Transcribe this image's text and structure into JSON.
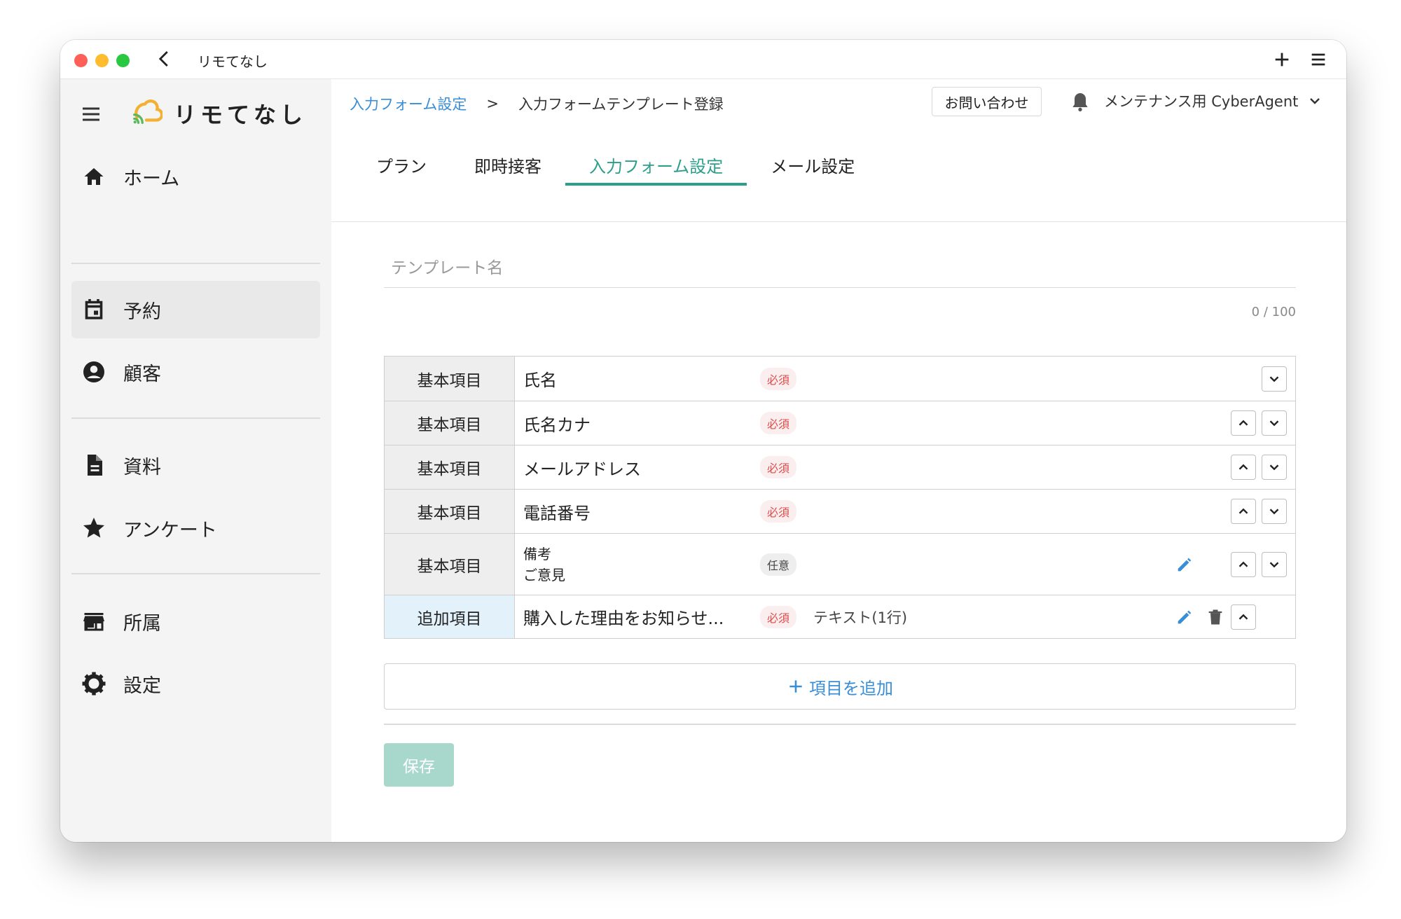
{
  "window": {
    "title": "リモてなし"
  },
  "sidebar": {
    "logo_text": "リモてなし",
    "items": [
      {
        "label": "ホーム",
        "icon": "home-icon"
      },
      {
        "label": "予約",
        "icon": "calendar-icon"
      },
      {
        "label": "顧客",
        "icon": "account-circle-icon"
      },
      {
        "label": "資料",
        "icon": "document-icon"
      },
      {
        "label": "アンケート",
        "icon": "star-icon"
      },
      {
        "label": "所属",
        "icon": "store-icon"
      },
      {
        "label": "設定",
        "icon": "gear-icon"
      }
    ]
  },
  "header": {
    "breadcrumb": {
      "link": "入力フォーム設定",
      "separator": ">",
      "current": "入力フォームテンプレート登録"
    },
    "contact_label": "お問い合わせ",
    "user_name": "メンテナンス用 CyberAgent",
    "tabs": [
      {
        "label": "プラン"
      },
      {
        "label": "即時接客"
      },
      {
        "label": "入力フォーム設定"
      },
      {
        "label": "メール設定"
      }
    ]
  },
  "form": {
    "template_name_placeholder": "テンプレート名",
    "template_name_value": "",
    "counter": "0 / 100",
    "rows": [
      {
        "category": "基本項目",
        "name": "氏名",
        "badge": "必須"
      },
      {
        "category": "基本項目",
        "name": "氏名カナ",
        "badge": "必須"
      },
      {
        "category": "基本項目",
        "name": "メールアドレス",
        "badge": "必須"
      },
      {
        "category": "基本項目",
        "name": "電話番号",
        "badge": "必須"
      },
      {
        "category": "基本項目",
        "name_line1": "備考",
        "name_line2": "ご意見",
        "badge": "任意"
      },
      {
        "category": "追加項目",
        "name": "購入した理由をお知らせ...",
        "badge": "必須",
        "type": "テキスト(1行)"
      }
    ],
    "add_label": "項目を追加",
    "save_label": "保存"
  },
  "colors": {
    "accent": "#2b9f8b",
    "link": "#3a8ed6",
    "required": "#e04b4b",
    "save_disabled": "#a8d8cc",
    "extra_row_bg": "#e3f1fb"
  }
}
